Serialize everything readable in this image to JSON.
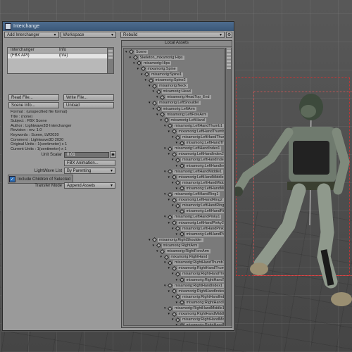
{
  "window": {
    "title": "Interchange"
  },
  "toolbar": {
    "add_label": "Add Interchanger",
    "workspace_label": "Workspace",
    "rebuild_label": "Rebuild"
  },
  "interchangers": {
    "headers": [
      "Interchanger",
      "Info"
    ],
    "rows": [
      {
        "name": "(FBX API)",
        "info": "(n/a)"
      }
    ]
  },
  "buttons": {
    "read_file": "Read File...",
    "write_file": "Write File...",
    "scene_info": "Scene Info...",
    "unload": "Unload",
    "fbx_animation": "FBX Animation..."
  },
  "info_lines": [
    "Format : (unspecified file format)",
    "Title : (none)",
    "Subject : FBX Scene",
    "Author : Lightwave3D Interchanger",
    "Revision : rev. 1.0",
    "Keywords : Scene, LW2020",
    "Comment : Lightwave3D 2020",
    "Original Units : 1(centimeter) x 1",
    "Current Units : 1(centimeter) x 1"
  ],
  "unit_scalar": {
    "label": "Unit Scalar",
    "value": "0.01"
  },
  "lightwave_list": {
    "label": "LightWave List",
    "value": "By Parenting"
  },
  "include_children": {
    "label": "Include Children of Selected",
    "checked": true
  },
  "transfer_mode": {
    "label": "Transfer Mode",
    "value": "Append Assets"
  },
  "tree": {
    "title": "Local Assets",
    "items": [
      {
        "label": "Scene",
        "depth": 0
      },
      {
        "label": "Skeleton_mixamorig:Hips",
        "depth": 1
      },
      {
        "label": "mixamorig:Hips",
        "depth": 2
      },
      {
        "label": "mixamorig:Spine",
        "depth": 3
      },
      {
        "label": "mixamorig:Spine1",
        "depth": 4
      },
      {
        "label": "mixamorig:Spine2",
        "depth": 5
      },
      {
        "label": "mixamorig:Neck",
        "depth": 6
      },
      {
        "label": "mixamorig:Head",
        "depth": 7
      },
      {
        "label": "mixamorig:HeadTop_End",
        "depth": 8
      },
      {
        "label": "mixamorig:LeftShoulder",
        "depth": 6
      },
      {
        "label": "mixamorig:LeftArm",
        "depth": 7
      },
      {
        "label": "mixamorig:LeftForeArm",
        "depth": 8
      },
      {
        "label": "mixamorig:LeftHand",
        "depth": 9
      },
      {
        "label": "mixamorig:LeftHandThumb1",
        "depth": 10
      },
      {
        "label": "mixamorig:LeftHandThumb2",
        "depth": 11
      },
      {
        "label": "mixamorig:LeftHandThumb3",
        "depth": 12
      },
      {
        "label": "mixamorig:LeftHandThumb4",
        "depth": 13
      },
      {
        "label": "mixamorig:LeftHandIndex1",
        "depth": 10
      },
      {
        "label": "mixamorig:LeftHandIndex2",
        "depth": 11
      },
      {
        "label": "mixamorig:LeftHandIndex3",
        "depth": 12
      },
      {
        "label": "mixamorig:LeftHandIndex4",
        "depth": 13
      },
      {
        "label": "mixamorig:LeftHandMiddle1",
        "depth": 10
      },
      {
        "label": "mixamorig:LeftHandMiddle2",
        "depth": 11
      },
      {
        "label": "mixamorig:LeftHandMiddle3",
        "depth": 12
      },
      {
        "label": "mixamorig:LeftHandMiddle4",
        "depth": 13
      },
      {
        "label": "mixamorig:LeftHandRing1",
        "depth": 10
      },
      {
        "label": "mixamorig:LeftHandRing2",
        "depth": 11
      },
      {
        "label": "mixamorig:LeftHandRing3",
        "depth": 12
      },
      {
        "label": "mixamorig:LeftHandRing4",
        "depth": 13
      },
      {
        "label": "mixamorig:LeftHandPinky1",
        "depth": 10
      },
      {
        "label": "mixamorig:LeftHandPinky2",
        "depth": 11
      },
      {
        "label": "mixamorig:LeftHandPinky3",
        "depth": 12
      },
      {
        "label": "mixamorig:LeftHandPinky4",
        "depth": 13
      },
      {
        "label": "mixamorig:RightShoulder",
        "depth": 6
      },
      {
        "label": "mixamorig:RightArm",
        "depth": 7
      },
      {
        "label": "mixamorig:RightForeArm",
        "depth": 8
      },
      {
        "label": "mixamorig:RightHand",
        "depth": 9
      },
      {
        "label": "mixamorig:RightHandThumb1",
        "depth": 10
      },
      {
        "label": "mixamorig:RightHandThumb2",
        "depth": 11
      },
      {
        "label": "mixamorig:RightHandThumb3",
        "depth": 12
      },
      {
        "label": "mixamorig:RightHandThumb4",
        "depth": 13
      },
      {
        "label": "mixamorig:RightHandIndex1",
        "depth": 10
      },
      {
        "label": "mixamorig:RightHandIndex2",
        "depth": 11
      },
      {
        "label": "mixamorig:RightHandIndex3",
        "depth": 12
      },
      {
        "label": "mixamorig:RightHandIndex4",
        "depth": 13
      },
      {
        "label": "mixamorig:RightHandMiddle1",
        "depth": 10
      },
      {
        "label": "mixamorig:RightHandMiddle2",
        "depth": 11
      },
      {
        "label": "mixamorig:RightHandMiddle3",
        "depth": 12
      },
      {
        "label": "mixamorig:RightHandMiddle4",
        "depth": 13
      },
      {
        "label": "mixamorig:RightHandRing1",
        "depth": 10
      }
    ]
  }
}
